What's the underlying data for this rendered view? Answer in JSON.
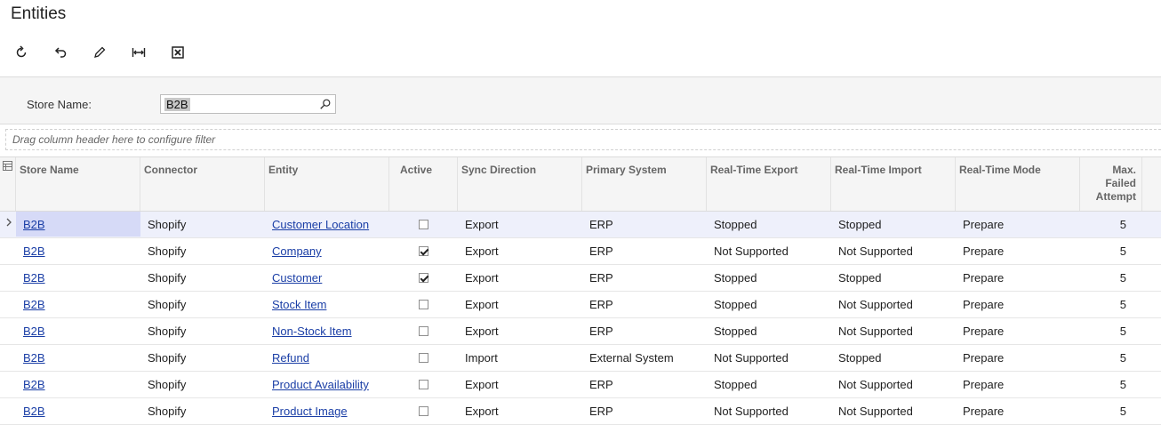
{
  "page": {
    "title": "Entities"
  },
  "toolbar": {
    "buttons": [
      {
        "name": "refresh-button",
        "icon": "refresh-icon"
      },
      {
        "name": "undo-button",
        "icon": "undo-icon"
      },
      {
        "name": "edit-button",
        "icon": "pencil-icon"
      },
      {
        "name": "fit-columns-button",
        "icon": "fit-width-icon"
      },
      {
        "name": "export-excel-button",
        "icon": "excel-icon"
      }
    ]
  },
  "filter": {
    "store_label": "Store Name:",
    "store_value": "B2B",
    "drag_hint": "Drag column header here to configure filter"
  },
  "grid": {
    "columns": {
      "store": "Store Name",
      "connector": "Connector",
      "entity": "Entity",
      "active": "Active",
      "sync": "Sync Direction",
      "primary": "Primary System",
      "rt_export": "Real-Time Export",
      "rt_import": "Real-Time Import",
      "rt_mode": "Real-Time Mode",
      "max_failed_1": "Max.",
      "max_failed_2": "Failed",
      "max_failed_3": "Attempt"
    },
    "rows": [
      {
        "store": "B2B",
        "connector": "Shopify",
        "entity": "Customer Location",
        "active": false,
        "sync": "Export",
        "primary": "ERP",
        "rt_export": "Stopped",
        "rt_import": "Stopped",
        "rt_mode": "Prepare",
        "max_failed": "5"
      },
      {
        "store": "B2B",
        "connector": "Shopify",
        "entity": "Company",
        "active": true,
        "sync": "Export",
        "primary": "ERP",
        "rt_export": "Not Supported",
        "rt_import": "Not Supported",
        "rt_mode": "Prepare",
        "max_failed": "5"
      },
      {
        "store": "B2B",
        "connector": "Shopify",
        "entity": "Customer",
        "active": true,
        "sync": "Export",
        "primary": "ERP",
        "rt_export": "Stopped",
        "rt_import": "Stopped",
        "rt_mode": "Prepare",
        "max_failed": "5"
      },
      {
        "store": "B2B",
        "connector": "Shopify",
        "entity": "Stock Item",
        "active": false,
        "sync": "Export",
        "primary": "ERP",
        "rt_export": "Stopped",
        "rt_import": "Not Supported",
        "rt_mode": "Prepare",
        "max_failed": "5"
      },
      {
        "store": "B2B",
        "connector": "Shopify",
        "entity": "Non-Stock Item",
        "active": false,
        "sync": "Export",
        "primary": "ERP",
        "rt_export": "Stopped",
        "rt_import": "Not Supported",
        "rt_mode": "Prepare",
        "max_failed": "5"
      },
      {
        "store": "B2B",
        "connector": "Shopify",
        "entity": "Refund",
        "active": false,
        "sync": "Import",
        "primary": "External System",
        "rt_export": "Not Supported",
        "rt_import": "Stopped",
        "rt_mode": "Prepare",
        "max_failed": "5"
      },
      {
        "store": "B2B",
        "connector": "Shopify",
        "entity": "Product Availability",
        "active": false,
        "sync": "Export",
        "primary": "ERP",
        "rt_export": "Stopped",
        "rt_import": "Not Supported",
        "rt_mode": "Prepare",
        "max_failed": "5"
      },
      {
        "store": "B2B",
        "connector": "Shopify",
        "entity": "Product Image",
        "active": false,
        "sync": "Export",
        "primary": "ERP",
        "rt_export": "Not Supported",
        "rt_import": "Not Supported",
        "rt_mode": "Prepare",
        "max_failed": "5"
      }
    ]
  }
}
